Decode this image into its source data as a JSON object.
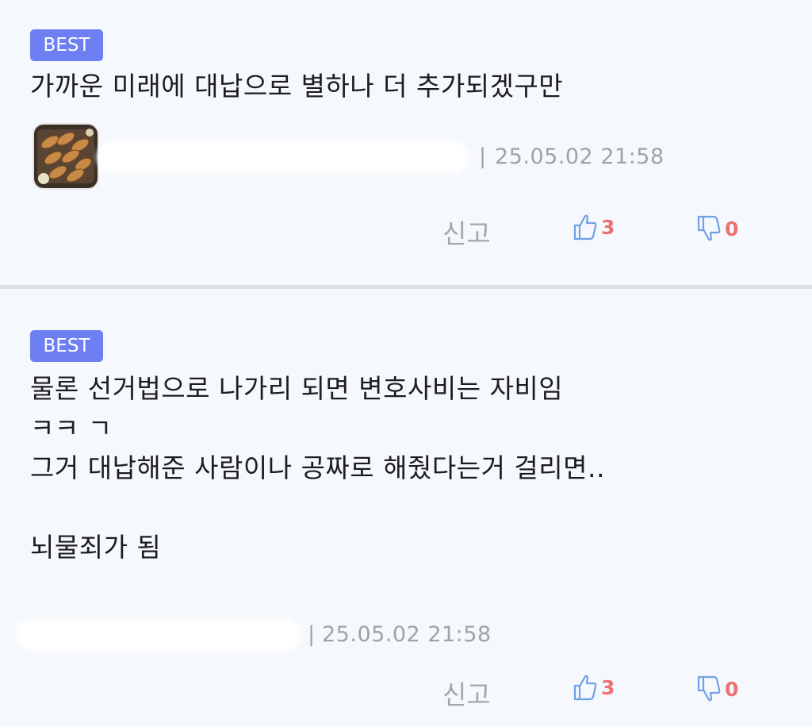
{
  "colors": {
    "badge": "#6d7ff2",
    "count": "#ef7070",
    "icon": "#6fa0e8",
    "meta": "#a2a2a6"
  },
  "comments": [
    {
      "badge": "BEST",
      "text": "가까운 미래에 대납으로 별하나 더 추가되겠구만",
      "separator": "|",
      "date": "25.05.02 21:58",
      "report_label": "신고",
      "like_icon": "thumbs-up-icon",
      "likes": "3",
      "dislike_icon": "thumbs-down-icon",
      "dislikes": "0"
    },
    {
      "badge": "BEST",
      "text": "물론 선거법으로 나가리 되면 변호사비는 자비임\nㅋㅋ ㄱ\n그거 대납해준 사람이나 공짜로 해줬다는거 걸리면..\n\n뇌물죄가 됨",
      "separator": "|",
      "date": "25.05.02 21:58",
      "report_label": "신고",
      "like_icon": "thumbs-up-icon",
      "likes": "3",
      "dislike_icon": "thumbs-down-icon",
      "dislikes": "0"
    }
  ]
}
